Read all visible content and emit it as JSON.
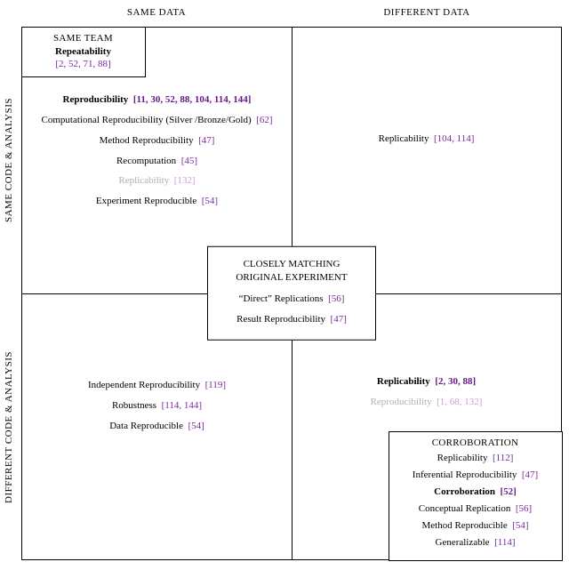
{
  "axes": {
    "top_left": "SAME DATA",
    "top_right": "DIFFERENT DATA",
    "left_top": "SAME CODE & ANALYSIS",
    "left_bottom": "DIFFERENT CODE & ANALYSIS"
  },
  "same_team": {
    "title": "SAME TEAM",
    "label": "Repeatability",
    "cites": "[2, 52, 71, 88]"
  },
  "center": {
    "title1": "CLOSELY MATCHING",
    "title2": "ORIGINAL EXPERIMENT",
    "e1_label": "“Direct” Replications",
    "e1_cite": "[56]",
    "e2_label": "Result Reproducibility",
    "e2_cite": "[47]"
  },
  "quad_tl": {
    "e1_label": "Reproducibility",
    "e1_cite": "[11, 30, 52, 88, 104, 114, 144]",
    "e2_label": "Computational Reproducibility (Silver /Bronze/Gold)",
    "e2_cite": "[62]",
    "e3_label": "Method Reproducibility",
    "e3_cite": "[47]",
    "e4_label": "Recomputation",
    "e4_cite": "[45]",
    "e5_label": "Replicability",
    "e5_cite": "[132]",
    "e6_label": "Experiment Reproducible",
    "e6_cite": "[54]"
  },
  "quad_tr": {
    "e1_label": "Replicability",
    "e1_cite": "[104, 114]"
  },
  "quad_bl": {
    "e1_label": "Independent Reproducibility",
    "e1_cite": "[119]",
    "e2_label": "Robustness",
    "e2_cite": "[114, 144]",
    "e3_label": "Data Reproducible",
    "e3_cite": "[54]"
  },
  "quad_br": {
    "e1_label": "Replicability",
    "e1_cite": "[2, 30, 88]",
    "e2_label": "Reproducibility",
    "e2_cite": "[1, 68, 132]"
  },
  "corrob": {
    "title": "CORROBORATION",
    "e1_label": "Replicability",
    "e1_cite": "[112]",
    "e2_label": "Inferential Reproducibility",
    "e2_cite": "[47]",
    "e3_label": "Corroboration",
    "e3_cite": "[52]",
    "e4_label": "Conceptual Replication",
    "e4_cite": "[56]",
    "e5_label": "Method Reproducible",
    "e5_cite": "[54]",
    "e6_label": "Generalizable",
    "e6_cite": "[114]"
  }
}
